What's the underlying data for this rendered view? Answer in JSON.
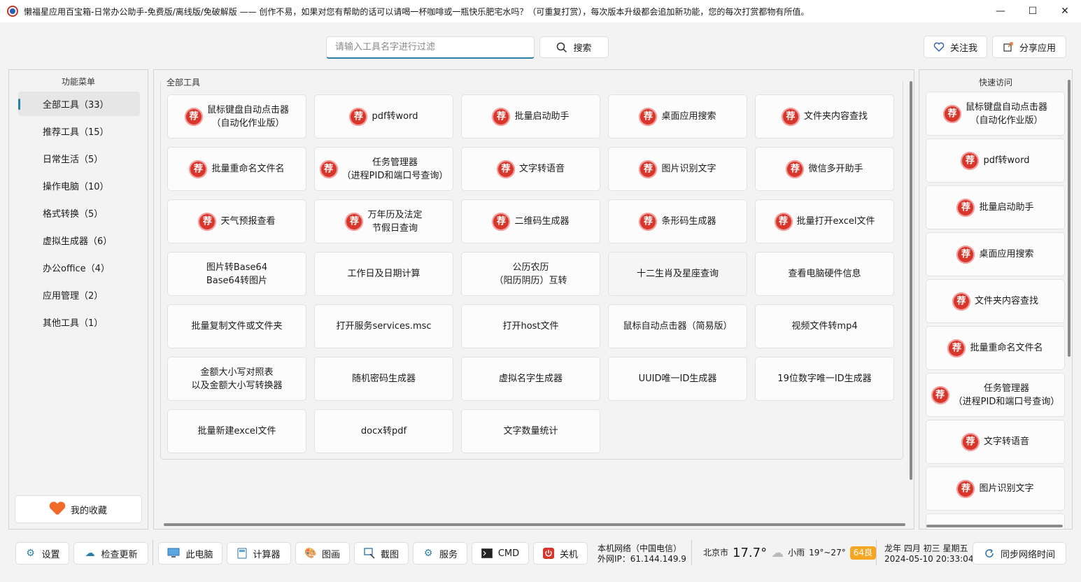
{
  "window": {
    "title": "懒福星应用百宝箱-日常办公助手-免费版/离线版/免破解版 —— 创作不易，如果对您有帮助的话可以请喝一杯咖啡或一瓶快乐肥宅水吗？（可重复打赏），每次版本升级都会追加新功能，您的每次打赏都物有所值。",
    "min": "—",
    "max": "☐",
    "close": "✕"
  },
  "search": {
    "placeholder": "请输入工具名字进行过滤",
    "button": "搜索"
  },
  "top_buttons": {
    "follow": "关注我",
    "share": "分享应用"
  },
  "left_menu": {
    "title": "功能菜单",
    "items": [
      "全部工具（33）",
      "推荐工具（15）",
      "日常生活（5）",
      "操作电脑（10）",
      "格式转换（5）",
      "虚拟生成器（6）",
      "办公office（4）",
      "应用管理（2）",
      "其他工具（1）"
    ],
    "favorites": "我的收藏"
  },
  "tools": {
    "title": "全部工具",
    "badge_char": "荐",
    "items": [
      {
        "label": "鼠标键盘自动点击器\n（自动化作业版）",
        "rec": true
      },
      {
        "label": "pdf转word",
        "rec": true
      },
      {
        "label": "批量启动助手",
        "rec": true
      },
      {
        "label": "桌面应用搜索",
        "rec": true
      },
      {
        "label": "文件夹内容查找",
        "rec": true
      },
      {
        "label": "批量重命名文件名",
        "rec": true
      },
      {
        "label": "任务管理器\n（进程PID和端口号查询）",
        "rec": true
      },
      {
        "label": "文字转语音",
        "rec": true
      },
      {
        "label": "图片识别文字",
        "rec": true
      },
      {
        "label": "微信多开助手",
        "rec": true
      },
      {
        "label": "天气预报查看",
        "rec": true
      },
      {
        "label": "万年历及法定\n节假日查询",
        "rec": true
      },
      {
        "label": "二维码生成器",
        "rec": true
      },
      {
        "label": "条形码生成器",
        "rec": true
      },
      {
        "label": "批量打开excel文件",
        "rec": true
      },
      {
        "label": "图片转Base64\nBase64转图片",
        "rec": false
      },
      {
        "label": "工作日及日期计算",
        "rec": false
      },
      {
        "label": "公历农历\n（阳历阴历）互转",
        "rec": false
      },
      {
        "label": "十二生肖及星座查询",
        "rec": false
      },
      {
        "label": "查看电脑硬件信息",
        "rec": false
      },
      {
        "label": "批量复制文件或文件夹",
        "rec": false
      },
      {
        "label": "打开服务services.msc",
        "rec": false
      },
      {
        "label": "打开host文件",
        "rec": false
      },
      {
        "label": "鼠标自动点击器（简易版）",
        "rec": false
      },
      {
        "label": "视频文件转mp4",
        "rec": false
      },
      {
        "label": "金额大小写对照表\n以及金额大小写转换器",
        "rec": false
      },
      {
        "label": "随机密码生成器",
        "rec": false
      },
      {
        "label": "虚拟名字生成器",
        "rec": false
      },
      {
        "label": "UUID唯一ID生成器",
        "rec": false
      },
      {
        "label": "19位数字唯一ID生成器",
        "rec": false
      },
      {
        "label": "批量新建excel文件",
        "rec": false
      },
      {
        "label": "docx转pdf",
        "rec": false
      },
      {
        "label": "文字数量统计",
        "rec": false
      }
    ]
  },
  "quick_access": {
    "title": "快速访问",
    "items": [
      "鼠标键盘自动点击器\n（自动化作业版）",
      "pdf转word",
      "批量启动助手",
      "桌面应用搜索",
      "文件夹内容查找",
      "批量重命名文件名",
      "任务管理器\n（进程PID和端口号查询）",
      "文字转语音",
      "图片识别文字"
    ]
  },
  "bottom": {
    "settings": "设置",
    "update": "检查更新",
    "this_pc": "此电脑",
    "calculator": "计算器",
    "paint": "图画",
    "screenshot": "截图",
    "services": "服务",
    "cmd": "CMD",
    "shutdown": "关机",
    "network_line1": "本机网络（中国电信）",
    "network_line2": "外网IP：61.144.149.9",
    "city": "北京市",
    "temp": "17.7°",
    "weather": "小雨",
    "range": "19°~27°",
    "aqi": "64良",
    "lunar": "龙年 四月 初三 星期五",
    "datetime": "2024-05-10 20:33:04",
    "sync": "同步网络时间"
  },
  "colors": {
    "badge": "#d8362a",
    "accent": "#2b7fa6",
    "aqi": "#f6a623",
    "heart": "#f26a2a"
  }
}
